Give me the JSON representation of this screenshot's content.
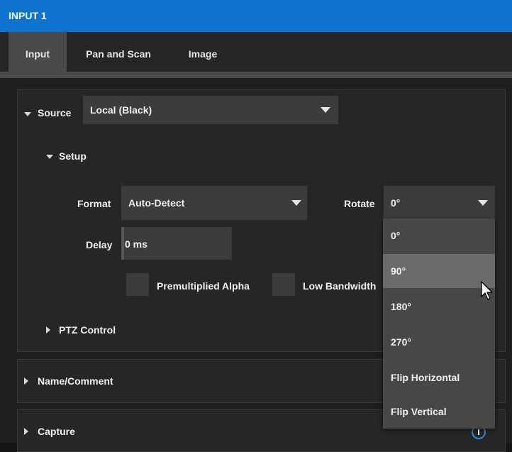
{
  "window": {
    "title": "INPUT 1"
  },
  "tabs": [
    {
      "label": "Input",
      "active": true
    },
    {
      "label": "Pan and Scan",
      "active": false
    },
    {
      "label": "Image",
      "active": false
    }
  ],
  "source": {
    "label": "Source",
    "value": "Local (Black)"
  },
  "setup": {
    "label": "Setup",
    "format_label": "Format",
    "format_value": "Auto-Detect",
    "rotate_label": "Rotate",
    "rotate_value": "0°",
    "delay_label": "Delay",
    "delay_value": "0 ms",
    "premultiplied_alpha_label": "Premultiplied Alpha",
    "low_bandwidth_label": "Low Bandwidth"
  },
  "ptz": {
    "label": "PTZ Control"
  },
  "name_comment": {
    "label": "Name/Comment"
  },
  "capture": {
    "label": "Capture"
  },
  "rotate_menu": {
    "options": [
      "0°",
      "90°",
      "180°",
      "270°",
      "Flip Horizontal",
      "Flip Vertical"
    ],
    "hovered": "90°"
  },
  "colors": {
    "title_bar": "#0c74cf",
    "background": "#1e1e1e",
    "field": "#3c3c3c",
    "menu": "#474747",
    "menu_hover": "#6a6a6a",
    "info_icon": "#2b8be0"
  },
  "icons": [
    "expand-triangle-icon",
    "collapse-triangle-icon",
    "dropdown-arrow-icon",
    "mouse-cursor-icon",
    "info-icon"
  ]
}
